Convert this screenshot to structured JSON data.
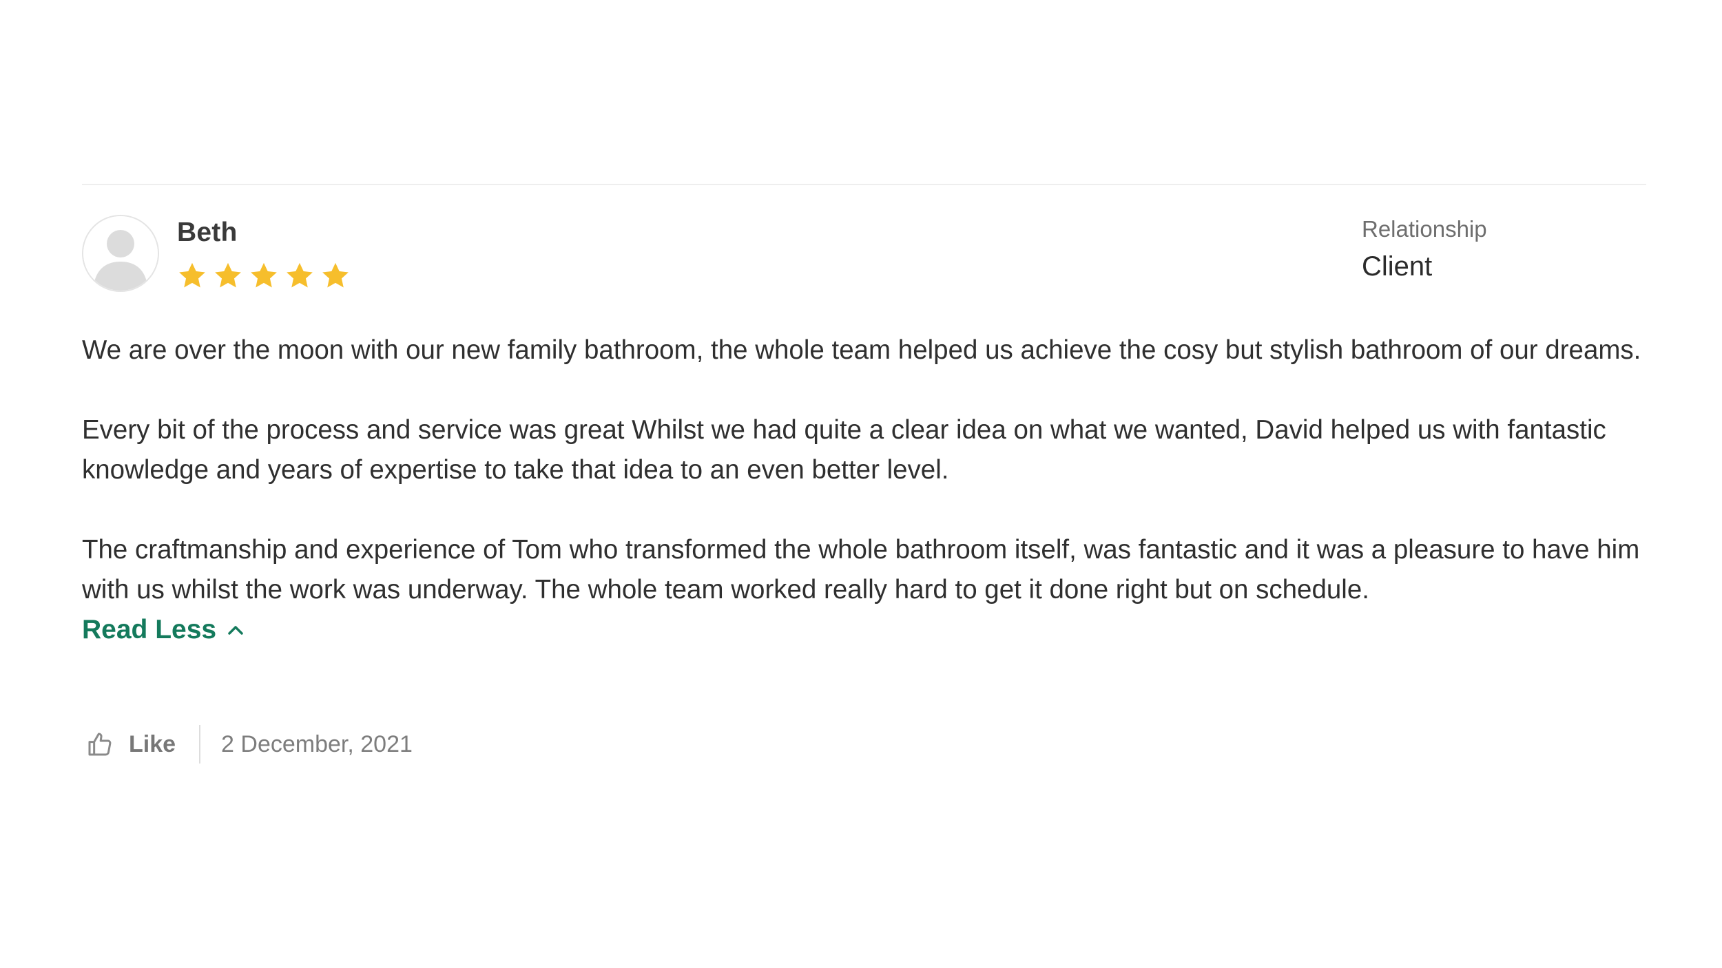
{
  "review": {
    "author": "Beth",
    "rating": 5,
    "rating_max": 5,
    "relationship_label": "Relationship",
    "relationship_value": "Client",
    "paragraphs": [
      "We are over the moon with our new family bathroom, the whole team helped us achieve the cosy but stylish bathroom of our dreams.",
      "Every bit of the process and service was great Whilst we had quite a clear idea on what we wanted, David helped us with fantastic knowledge and years of expertise to take that idea to an even better level.",
      "The craftmanship and experience of Tom who transformed the whole bathroom itself, was fantastic and it was a pleasure to have him with us whilst the work was underway. The whole team worked really hard to get it done right but on schedule."
    ],
    "read_less_label": "Read Less",
    "like_label": "Like",
    "date": "2 December, 2021"
  },
  "icons": {
    "avatar": "default-user-avatar-icon",
    "star": "star-icon",
    "read_less": "chevron-up-icon",
    "like": "thumbs-up-icon"
  },
  "colors": {
    "star": "#F6BE2C",
    "link": "#147A5C",
    "text": "#2F2F2F",
    "muted": "#777777"
  }
}
